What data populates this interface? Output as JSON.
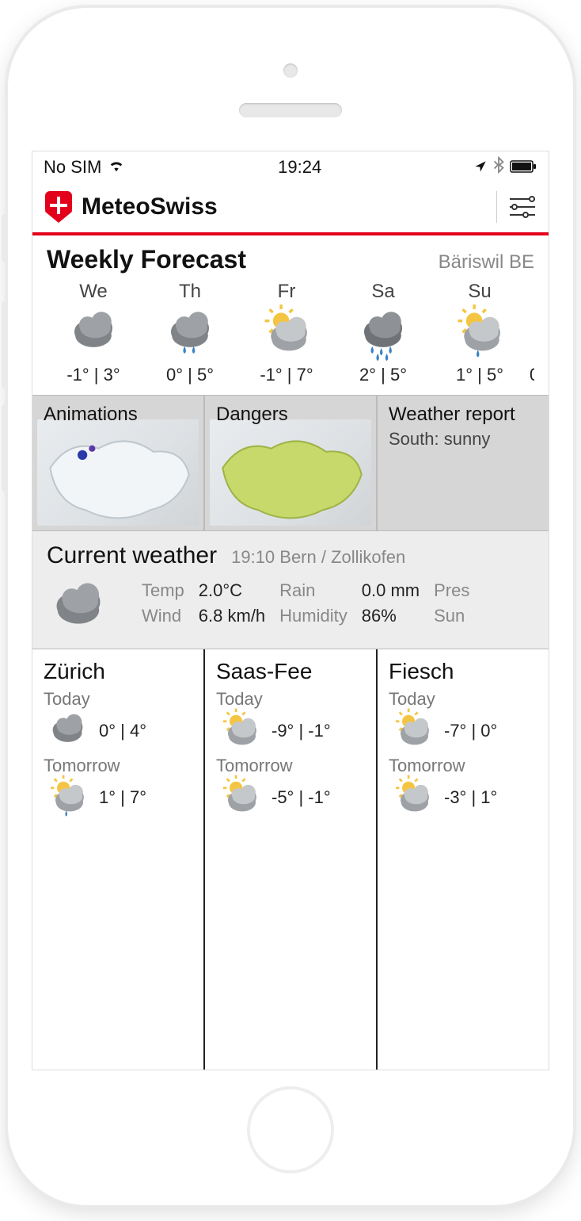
{
  "status": {
    "sim": "No SIM",
    "time": "19:24"
  },
  "header": {
    "brand": "MeteoSwiss"
  },
  "weekly": {
    "title": "Weekly Forecast",
    "location": "Bäriswil BE",
    "days": [
      {
        "name": "We",
        "low": "-1°",
        "high": "3°",
        "icon": "cloud"
      },
      {
        "name": "Th",
        "low": "0°",
        "high": "5°",
        "icon": "cloud-rain"
      },
      {
        "name": "Fr",
        "low": "-1°",
        "high": "7°",
        "icon": "sun-cloud"
      },
      {
        "name": "Sa",
        "low": "2°",
        "high": "5°",
        "icon": "cloud-heavy-rain"
      },
      {
        "name": "Su",
        "low": "1°",
        "high": "5°",
        "icon": "sun-cloud-rain"
      }
    ]
  },
  "tiles": {
    "animations": "Animations",
    "dangers": "Dangers",
    "report_title": "Weather report",
    "report_sub": "South: sunny"
  },
  "current": {
    "title": "Current weather",
    "meta": "19:10 Bern / Zollikofen",
    "icon": "cloud",
    "metrics": [
      {
        "label": "Temp",
        "value": "2.0°C"
      },
      {
        "label": "Wind",
        "value": "6.8 km/h"
      },
      {
        "label": "Rain",
        "value": "0.0 mm"
      },
      {
        "label": "Humidity",
        "value": "86%"
      },
      {
        "label": "Pres",
        "value": ""
      },
      {
        "label": "Sun",
        "value": ""
      }
    ]
  },
  "cities": [
    {
      "name": "Zürich",
      "today": {
        "label": "Today",
        "low": "0°",
        "high": "4°",
        "icon": "cloud"
      },
      "tomorrow": {
        "label": "Tomorrow",
        "low": "1°",
        "high": "7°",
        "icon": "sun-cloud-rain"
      }
    },
    {
      "name": "Saas-Fee",
      "today": {
        "label": "Today",
        "low": "-9°",
        "high": "-1°",
        "icon": "sun-cloud"
      },
      "tomorrow": {
        "label": "Tomorrow",
        "low": "-5°",
        "high": "-1°",
        "icon": "sun-cloud"
      }
    },
    {
      "name": "Fiesch",
      "today": {
        "label": "Today",
        "low": "-7°",
        "high": "0°",
        "icon": "sun-cloud"
      },
      "tomorrow": {
        "label": "Tomorrow",
        "low": "-3°",
        "high": "1°",
        "icon": "sun-cloud"
      }
    }
  ]
}
